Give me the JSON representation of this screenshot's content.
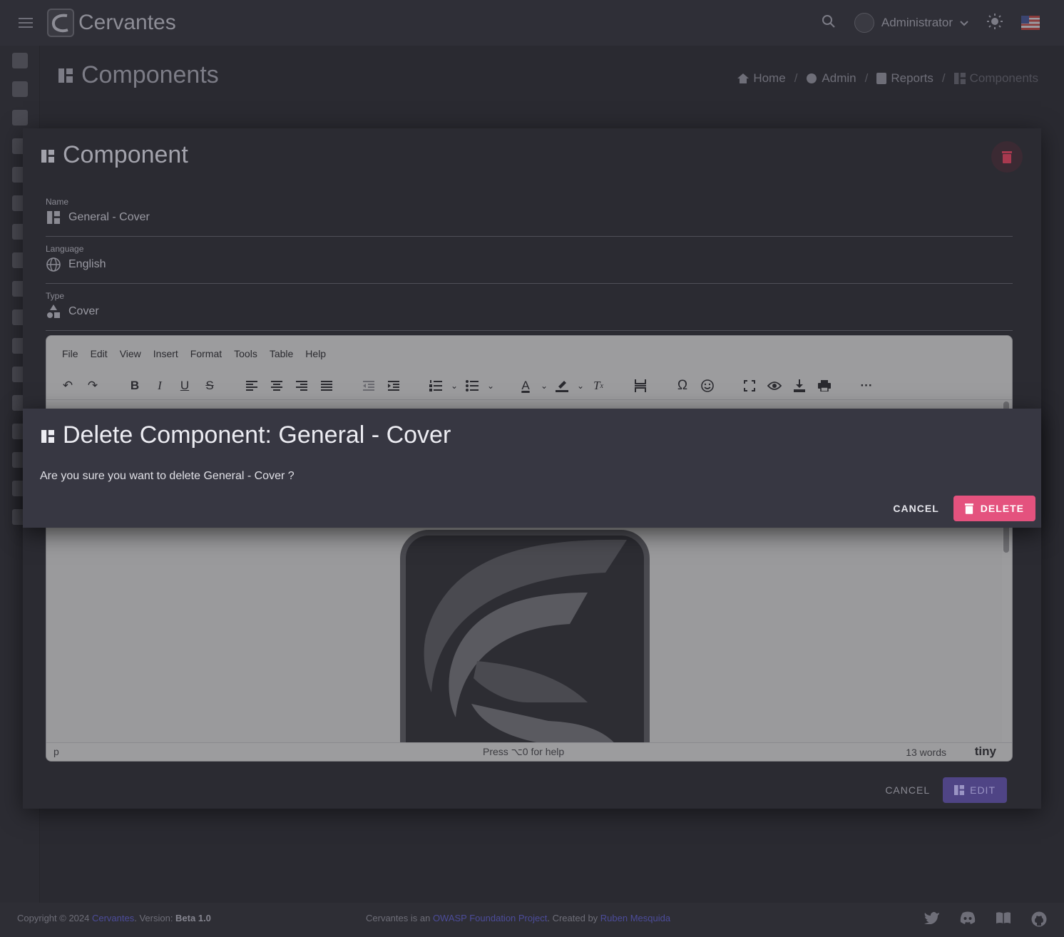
{
  "app": {
    "name": "Cervantes"
  },
  "header": {
    "user": "Administrator"
  },
  "page": {
    "title": "Components"
  },
  "breadcrumb": [
    {
      "label": "Home"
    },
    {
      "label": "Admin"
    },
    {
      "label": "Reports"
    },
    {
      "label": "Components"
    }
  ],
  "component_modal": {
    "title": "Component",
    "fields": {
      "name": {
        "label": "Name",
        "value": "General - Cover"
      },
      "language": {
        "label": "Language",
        "value": "English"
      },
      "type": {
        "label": "Type",
        "value": "Cover"
      }
    },
    "editor": {
      "menu": [
        "File",
        "Edit",
        "View",
        "Insert",
        "Format",
        "Tools",
        "Table",
        "Help"
      ],
      "status_tag": "p",
      "help_hint": "Press ⌥0 for help",
      "word_count": "13 words",
      "brand": "tiny"
    },
    "cancel_label": "CANCEL",
    "edit_label": "EDIT"
  },
  "delete_dialog": {
    "title": "Delete Component: General - Cover",
    "message": "Are you sure you want to delete General - Cover ?",
    "cancel_label": "CANCEL",
    "delete_label": "DELETE",
    "delete_color": "#e4527e"
  },
  "footer": {
    "copyright_prefix": "Copyright © 2024 ",
    "copyright_link": "Cervantes",
    "version_prefix": ". Version: ",
    "version": "Beta 1.0",
    "mid_prefix": "Cervantes is an ",
    "owasp_link": "OWASP Foundation Project",
    "created_by": ". Created by ",
    "author_link": "Ruben Mesquida"
  }
}
